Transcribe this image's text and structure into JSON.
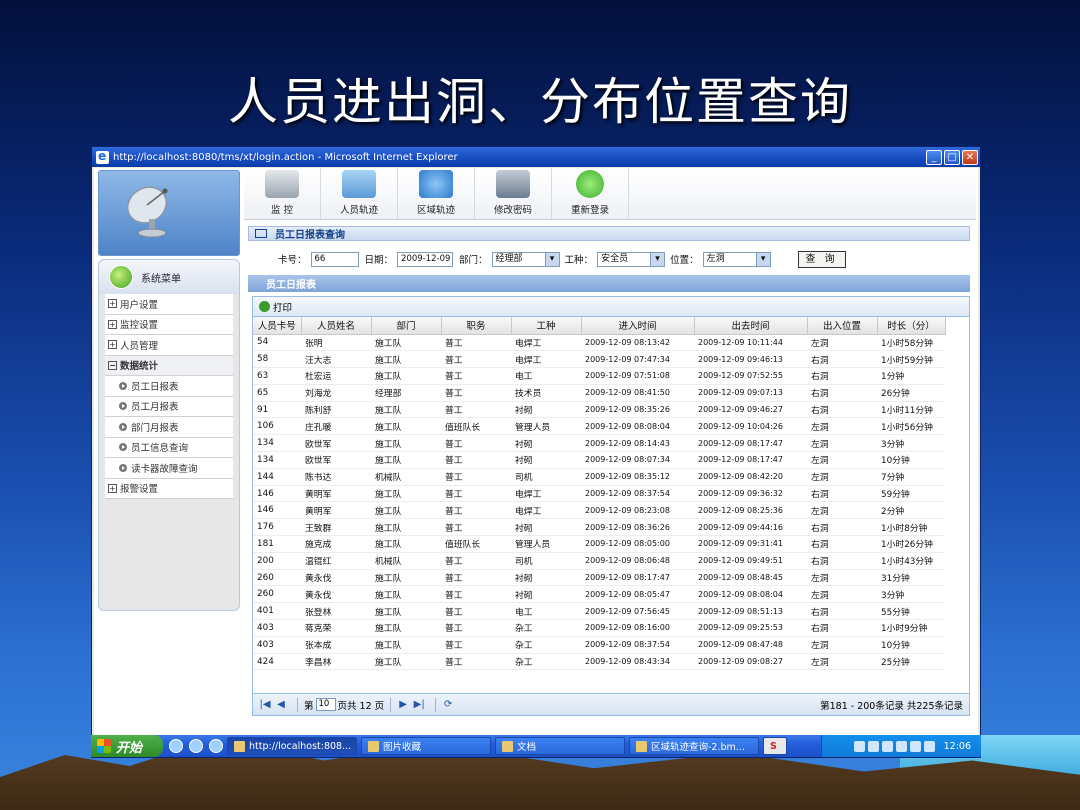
{
  "slide_title": "人员进出洞、分布位置查询",
  "browser": {
    "title": "http://localhost:8080/tms/xt/login.action - Microsoft Internet Explorer",
    "min": "_",
    "max": "□",
    "close": "✕"
  },
  "sidebar": {
    "menu_title": "系统菜单",
    "items": [
      {
        "label": "用户设置",
        "box": "+"
      },
      {
        "label": "监控设置",
        "box": "+"
      },
      {
        "label": "人员管理",
        "box": "+"
      },
      {
        "label": "数据统计",
        "box": "−"
      }
    ],
    "sub_items": [
      "员工日报表",
      "员工月报表",
      "部门月报表",
      "员工信息查询",
      "读卡器故障查询"
    ],
    "last_item": {
      "label": "报警设置",
      "box": "+"
    }
  },
  "toolbar": {
    "items": [
      {
        "label": "监  控",
        "color": "#9aa4ae"
      },
      {
        "label": "人员轨迹",
        "color": "#5a9ad8"
      },
      {
        "label": "区域轨迹",
        "color": "#2f7bd0"
      },
      {
        "label": "修改密码",
        "color": "#6a7c90"
      },
      {
        "label": "重新登录",
        "color": "#3ab030"
      }
    ]
  },
  "query": {
    "panel_title": "员工日报表查询",
    "card_label": "卡号：",
    "card_value": "66",
    "date_label": "日期：",
    "date_value": "2009-12-09",
    "dept_label": "部门：",
    "dept_value": "经理部",
    "type_label": "工种：",
    "type_value": "安全员",
    "pos_label": "位置：",
    "pos_value": "左洞",
    "button": "查 询"
  },
  "report": {
    "title": "员工日报表",
    "print": "打印",
    "columns": [
      "人员卡号",
      "人员姓名",
      "部门",
      "职务",
      "工种",
      "进入时间",
      "出去时间",
      "出入位置",
      "时长（分）"
    ],
    "rows": [
      [
        "54",
        "张明",
        "施工队",
        "普工",
        "电焊工",
        "2009-12-09 08:13:42",
        "2009-12-09 10:11:44",
        "左洞",
        "1小时58分钟"
      ],
      [
        "58",
        "汪大志",
        "施工队",
        "普工",
        "电焊工",
        "2009-12-09 07:47:34",
        "2009-12-09 09:46:13",
        "右洞",
        "1小时59分钟"
      ],
      [
        "63",
        "杜宏运",
        "施工队",
        "普工",
        "电工",
        "2009-12-09 07:51:08",
        "2009-12-09 07:52:55",
        "右洞",
        "1分钟"
      ],
      [
        "65",
        "刘海龙",
        "经理部",
        "普工",
        "技术员",
        "2009-12-09 08:41:50",
        "2009-12-09 09:07:13",
        "右洞",
        "26分钟"
      ],
      [
        "91",
        "陈利舒",
        "施工队",
        "普工",
        "衬砌",
        "2009-12-09 08:35:26",
        "2009-12-09 09:46:27",
        "右洞",
        "1小时11分钟"
      ],
      [
        "106",
        "庄孔暖",
        "施工队",
        "值班队长",
        "管理人员",
        "2009-12-09 08:08:04",
        "2009-12-09 10:04:26",
        "左洞",
        "1小时56分钟"
      ],
      [
        "134",
        "欧世军",
        "施工队",
        "普工",
        "衬砌",
        "2009-12-09 08:14:43",
        "2009-12-09 08:17:47",
        "左洞",
        "3分钟"
      ],
      [
        "134",
        "欧世军",
        "施工队",
        "普工",
        "衬砌",
        "2009-12-09 08:07:34",
        "2009-12-09 08:17:47",
        "左洞",
        "10分钟"
      ],
      [
        "144",
        "陈书达",
        "机械队",
        "普工",
        "司机",
        "2009-12-09 08:35:12",
        "2009-12-09 08:42:20",
        "左洞",
        "7分钟"
      ],
      [
        "146",
        "黄明军",
        "施工队",
        "普工",
        "电焊工",
        "2009-12-09 08:37:54",
        "2009-12-09 09:36:32",
        "右洞",
        "59分钟"
      ],
      [
        "146",
        "黄明军",
        "施工队",
        "普工",
        "电焊工",
        "2009-12-09 08:23:08",
        "2009-12-09 08:25:36",
        "左洞",
        "2分钟"
      ],
      [
        "176",
        "王致群",
        "施工队",
        "普工",
        "衬砌",
        "2009-12-09 08:36:26",
        "2009-12-09 09:44:16",
        "右洞",
        "1小时8分钟"
      ],
      [
        "181",
        "施克成",
        "施工队",
        "值班队长",
        "管理人员",
        "2009-12-09 08:05:00",
        "2009-12-09 09:31:41",
        "右洞",
        "1小时26分钟"
      ],
      [
        "200",
        "温锟红",
        "机械队",
        "普工",
        "司机",
        "2009-12-09 08:06:48",
        "2009-12-09 09:49:51",
        "右洞",
        "1小时43分钟"
      ],
      [
        "260",
        "黄永伐",
        "施工队",
        "普工",
        "衬砌",
        "2009-12-09 08:17:47",
        "2009-12-09 08:48:45",
        "左洞",
        "31分钟"
      ],
      [
        "260",
        "黄永伐",
        "施工队",
        "普工",
        "衬砌",
        "2009-12-09 08:05:47",
        "2009-12-09 08:08:04",
        "左洞",
        "3分钟"
      ],
      [
        "401",
        "张登林",
        "施工队",
        "普工",
        "电工",
        "2009-12-09 07:56:45",
        "2009-12-09 08:51:13",
        "右洞",
        "55分钟"
      ],
      [
        "403",
        "蒋克荣",
        "施工队",
        "普工",
        "杂工",
        "2009-12-09 08:16:00",
        "2009-12-09 09:25:53",
        "右洞",
        "1小时9分钟"
      ],
      [
        "403",
        "张本成",
        "施工队",
        "普工",
        "杂工",
        "2009-12-09 08:37:54",
        "2009-12-09 08:47:48",
        "左洞",
        "10分钟"
      ],
      [
        "424",
        "李昌林",
        "施工队",
        "普工",
        "杂工",
        "2009-12-09 08:43:34",
        "2009-12-09 09:08:27",
        "左洞",
        "25分钟"
      ]
    ],
    "pager": {
      "first": "|◀",
      "prev": "◀",
      "page_prefix": "第",
      "page_value": "10",
      "page_suffix": "页共 12 页",
      "next": "▶",
      "last": "▶|",
      "refresh": "⟳",
      "info": "第181 - 200条记录 共225条记录"
    }
  },
  "taskbar": {
    "start": "开始",
    "tasks": [
      "http://localhost:808...",
      "图片收藏",
      "文档",
      "区域轨迹查询-2.bm...",
      "S"
    ],
    "clock": "12:06"
  }
}
